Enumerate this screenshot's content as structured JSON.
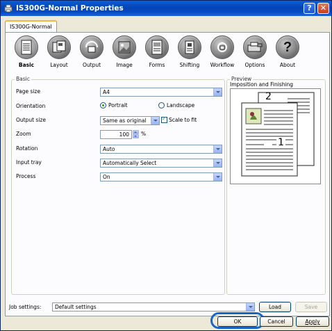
{
  "window": {
    "title": "IS300G-Normal Properties",
    "help_glyph": "?",
    "close_glyph": "✕"
  },
  "tab": {
    "label": "IS300G-Normal"
  },
  "toolbar": {
    "items": [
      {
        "label": "Basic",
        "icon": "basic-doc-icon",
        "selected": true
      },
      {
        "label": "Layout",
        "icon": "layout-icon",
        "selected": false
      },
      {
        "label": "Output",
        "icon": "output-icon",
        "selected": false
      },
      {
        "label": "Image",
        "icon": "image-icon",
        "selected": false
      },
      {
        "label": "Forms",
        "icon": "forms-icon",
        "selected": false
      },
      {
        "label": "Shifting",
        "icon": "shifting-icon",
        "selected": false
      },
      {
        "label": "Workflow",
        "icon": "workflow-icon",
        "selected": false
      },
      {
        "label": "Options",
        "icon": "options-icon",
        "selected": false
      },
      {
        "label": "About",
        "icon": "about-icon",
        "selected": false
      }
    ]
  },
  "basic": {
    "legend": "Basic",
    "page_size": {
      "label": "Page size",
      "value": "A4"
    },
    "orientation": {
      "label": "Orientation",
      "portrait": "Portrait",
      "landscape": "Landscape",
      "selected": "portrait"
    },
    "output_size": {
      "label": "Output size",
      "value": "Same as original",
      "scale_label": "Scale to fit",
      "scale_checked": true
    },
    "zoom": {
      "label": "Zoom",
      "value": "100",
      "unit": "%"
    },
    "rotation": {
      "label": "Rotation",
      "value": "Auto"
    },
    "input_tray": {
      "label": "Input tray",
      "value": "Automatically Select"
    },
    "process": {
      "label": "Process",
      "value": "On"
    }
  },
  "preview": {
    "legend": "Preview",
    "caption": "Imposition and Finishing",
    "page_front_number": "1",
    "page_back_number": "2"
  },
  "job": {
    "label": "Job settings:",
    "value": "Default settings",
    "load_label": "Load",
    "save_label": "Save"
  },
  "footer": {
    "ok_label": "OK",
    "cancel_label": "Cancel",
    "apply_label": "Apply"
  },
  "colors": {
    "titlebar": "#0443b5",
    "tab_highlight": "#f6b642",
    "ok_highlight_ring": "#1a66c6"
  }
}
